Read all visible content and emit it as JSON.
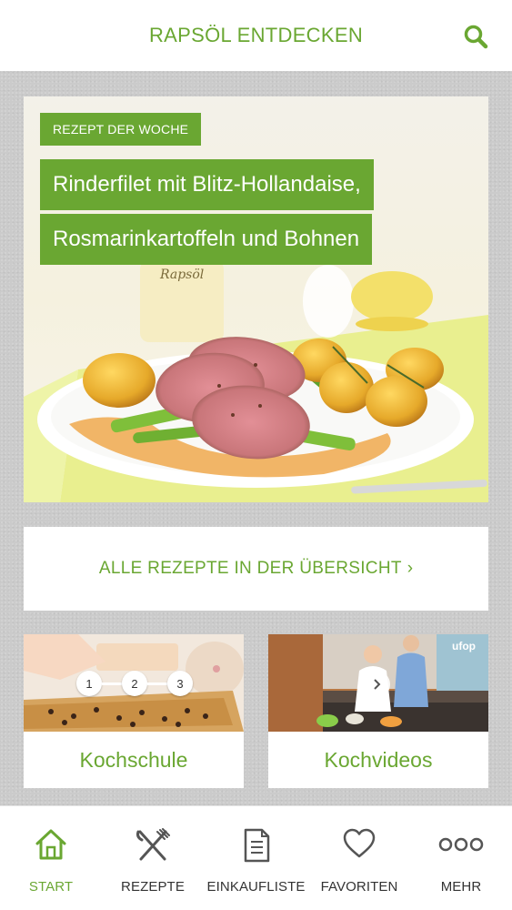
{
  "header": {
    "title": "RAPSÖL ENTDECKEN",
    "search_icon": "search-icon"
  },
  "hero": {
    "badge": "REZEPT DER WOCHE",
    "title_line1": "Rinderfilet mit Blitz-Hollandaise,",
    "title_line2": "Rosmarinkartoffeln und Bohnen",
    "bottle_label": "Rapsöl"
  },
  "all_recipes": {
    "label": "ALLE REZEPTE IN DER ÜBERSICHT",
    "chevron": "›"
  },
  "tiles": [
    {
      "label": "Kochschule",
      "steps": [
        "1",
        "2",
        "3"
      ]
    },
    {
      "label": "Kochvideos",
      "logo": "ufop"
    }
  ],
  "tabbar": {
    "items": [
      {
        "label": "START",
        "icon": "home-icon",
        "active": true
      },
      {
        "label": "REZEPTE",
        "icon": "fork-knife-icon",
        "active": false
      },
      {
        "label": "EINKAUFLISTE",
        "icon": "list-icon",
        "active": false
      },
      {
        "label": "FAVORITEN",
        "icon": "heart-icon",
        "active": false
      },
      {
        "label": "MEHR",
        "icon": "more-icon",
        "active": false
      }
    ]
  },
  "colors": {
    "brand_green": "#6aa732",
    "text_dark": "#333333",
    "background": "#cbcbcb"
  }
}
